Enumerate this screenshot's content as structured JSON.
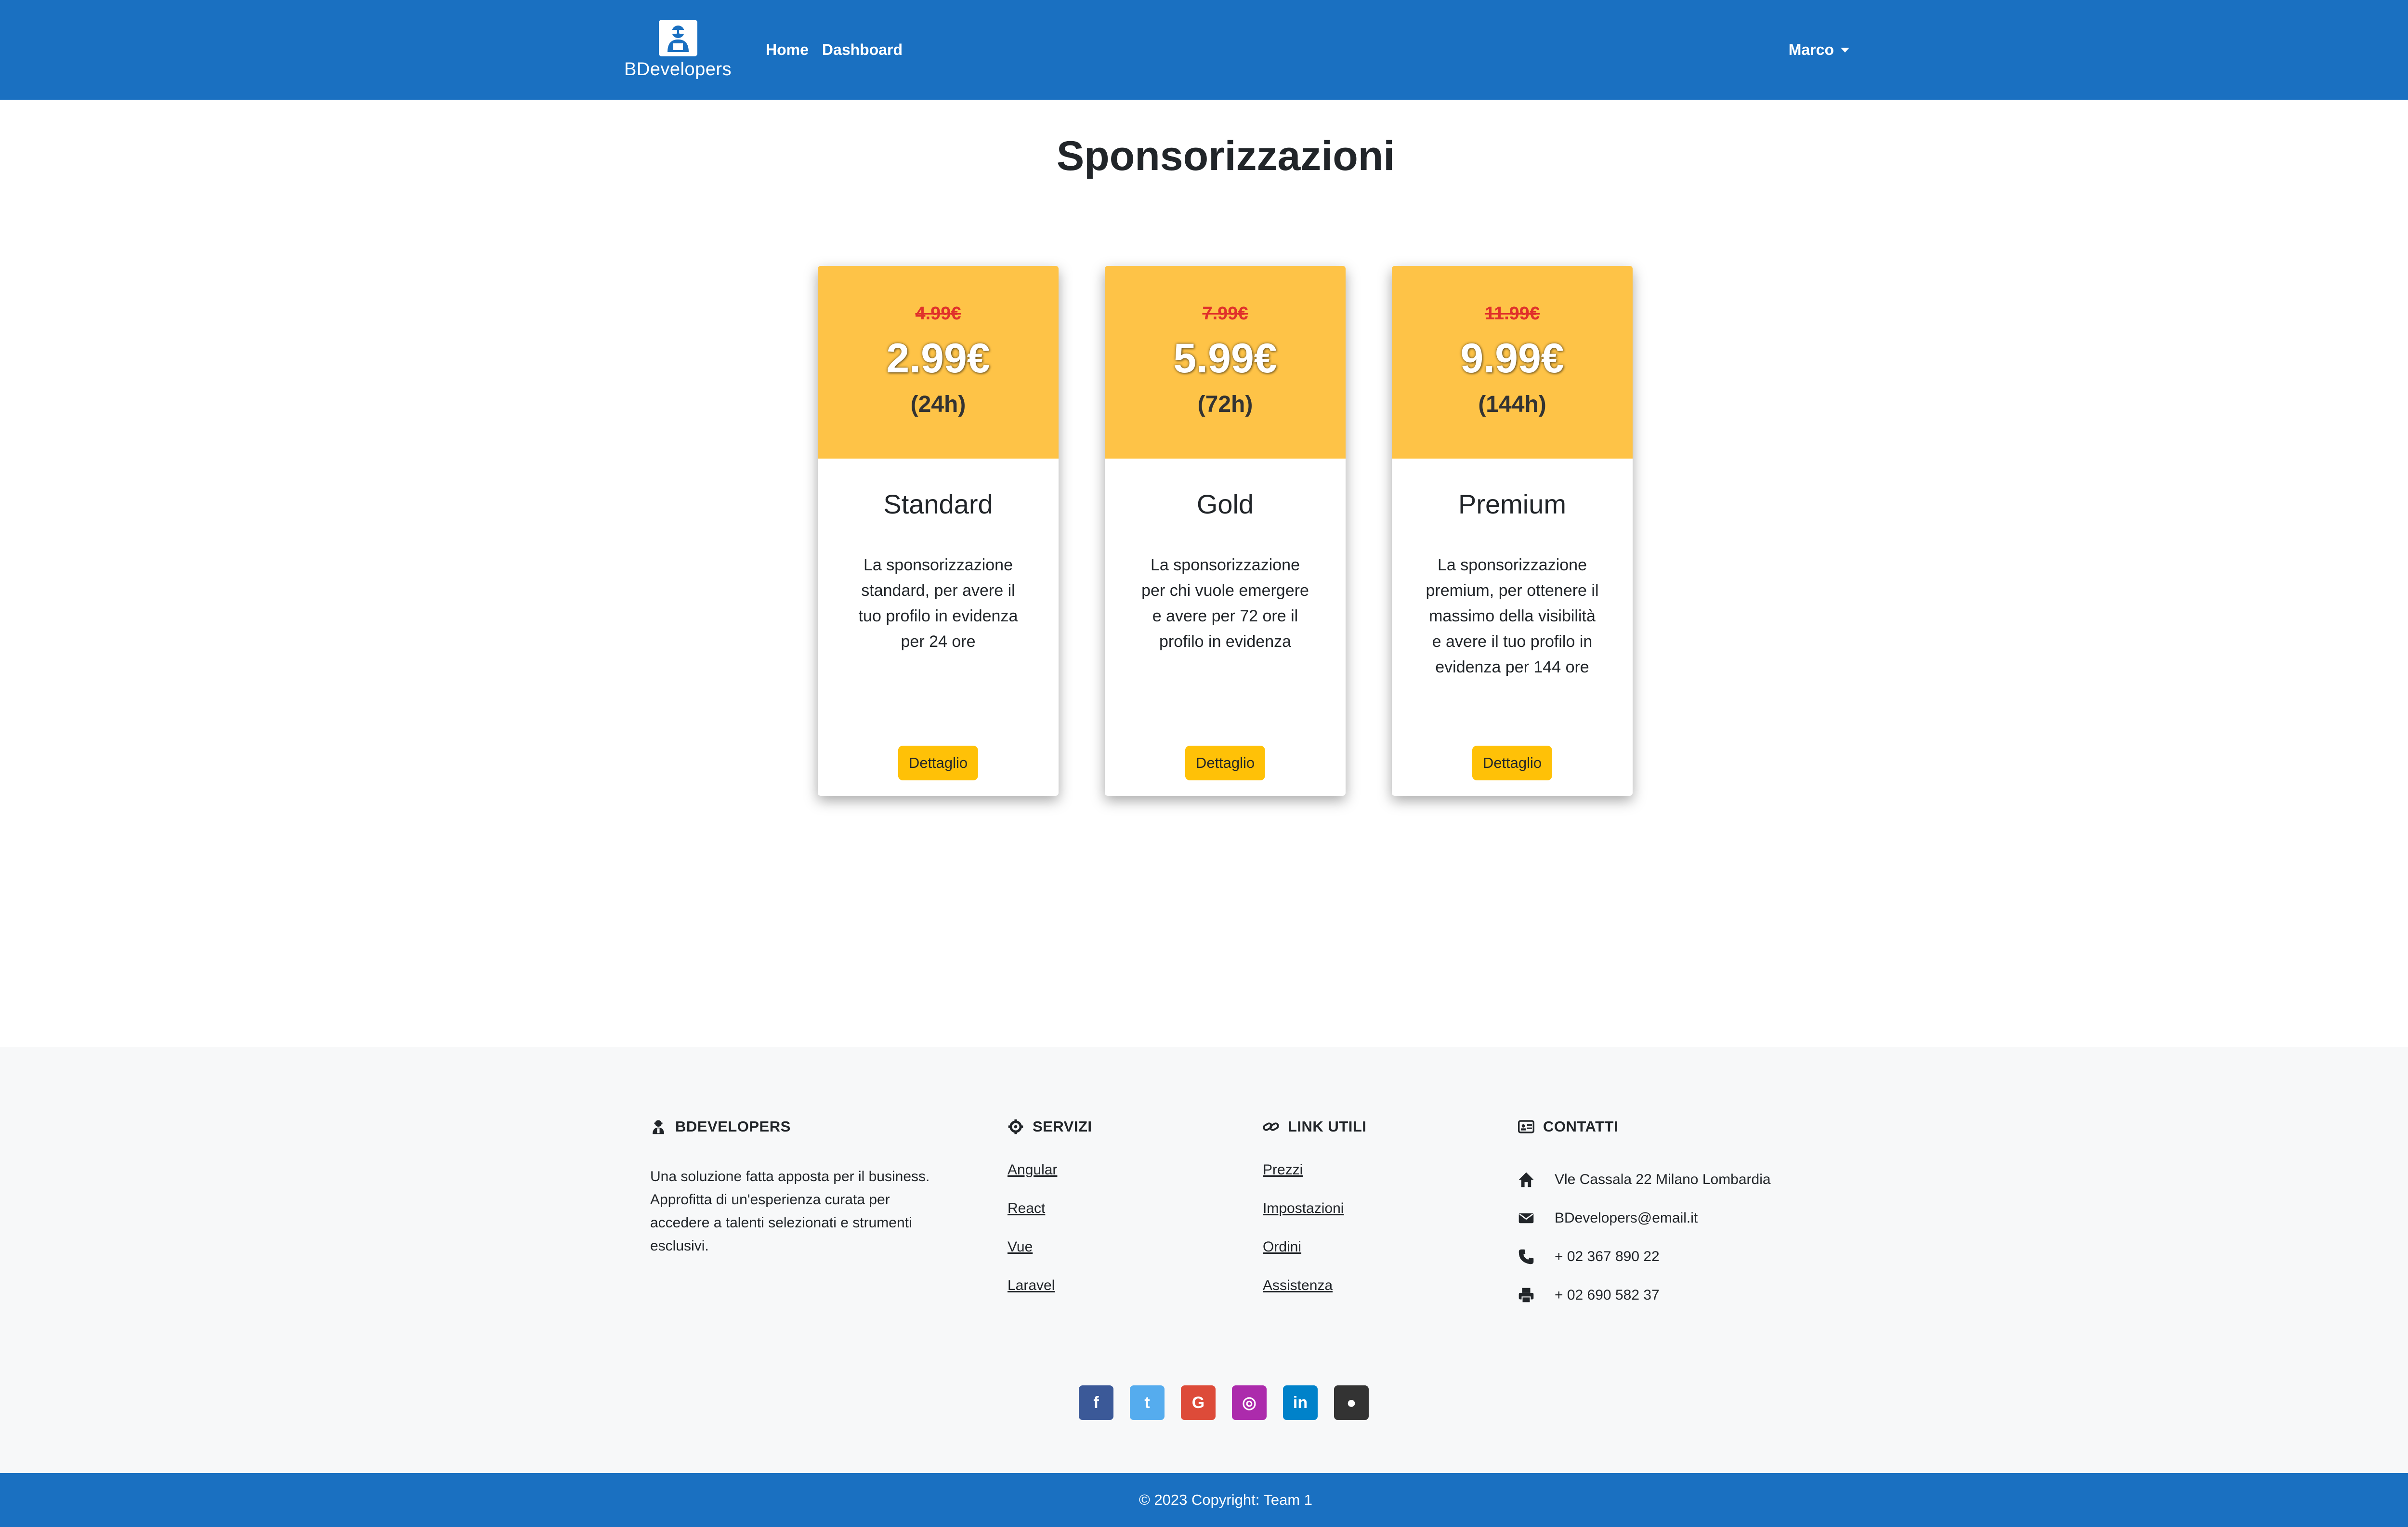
{
  "navbar": {
    "brand": "BDevelopers",
    "links": [
      "Home",
      "Dashboard"
    ],
    "user": "Marco"
  },
  "main": {
    "title": "Sponsorizzazioni",
    "plans": [
      {
        "old_price": "4.99€",
        "price": "2.99€",
        "duration": "(24h)",
        "name": "Standard",
        "description": "La sponsorizzazione standard, per avere il tuo profilo in evidenza per 24 ore",
        "button": "Dettaglio"
      },
      {
        "old_price": "7.99€",
        "price": "5.99€",
        "duration": "(72h)",
        "name": "Gold",
        "description": "La sponsorizzazione per chi vuole emergere e avere per 72 ore il profilo in evidenza",
        "button": "Dettaglio"
      },
      {
        "old_price": "11.99€",
        "price": "9.99€",
        "duration": "(144h)",
        "name": "Premium",
        "description": "La sponsorizzazione premium, per ottenere il massimo della visibilità e avere il tuo profilo in evidenza per 144 ore",
        "button": "Dettaglio"
      }
    ]
  },
  "footer": {
    "about": {
      "title": "BDEVELOPERS",
      "text": "Una soluzione fatta apposta per il business. Approfitta di un'esperienza curata per accedere a talenti selezionati e strumenti esclusivi."
    },
    "services": {
      "title": "SERVIZI",
      "links": [
        "Angular",
        "React",
        "Vue",
        "Laravel"
      ]
    },
    "useful": {
      "title": "LINK UTILI",
      "links": [
        "Prezzi",
        "Impostazioni",
        "Ordini",
        "Assistenza"
      ]
    },
    "contacts": {
      "title": "CONTATTI",
      "address": "Vle Cassala 22 Milano Lombardia",
      "email": "BDevelopers@email.it",
      "phone": "+ 02 367 890 22",
      "fax": "+ 02 690 582 37"
    },
    "socials": [
      {
        "name": "facebook",
        "glyph": "f",
        "color": "#3b5998"
      },
      {
        "name": "twitter",
        "glyph": "t",
        "color": "#55acee"
      },
      {
        "name": "google",
        "glyph": "G",
        "color": "#dd4b39"
      },
      {
        "name": "instagram",
        "glyph": "◎",
        "color": "#ac2bac"
      },
      {
        "name": "linkedin",
        "glyph": "in",
        "color": "#0082ca"
      },
      {
        "name": "github",
        "glyph": "●",
        "color": "#333333"
      }
    ],
    "copyright": "© 2023 Copyright: Team 1"
  }
}
